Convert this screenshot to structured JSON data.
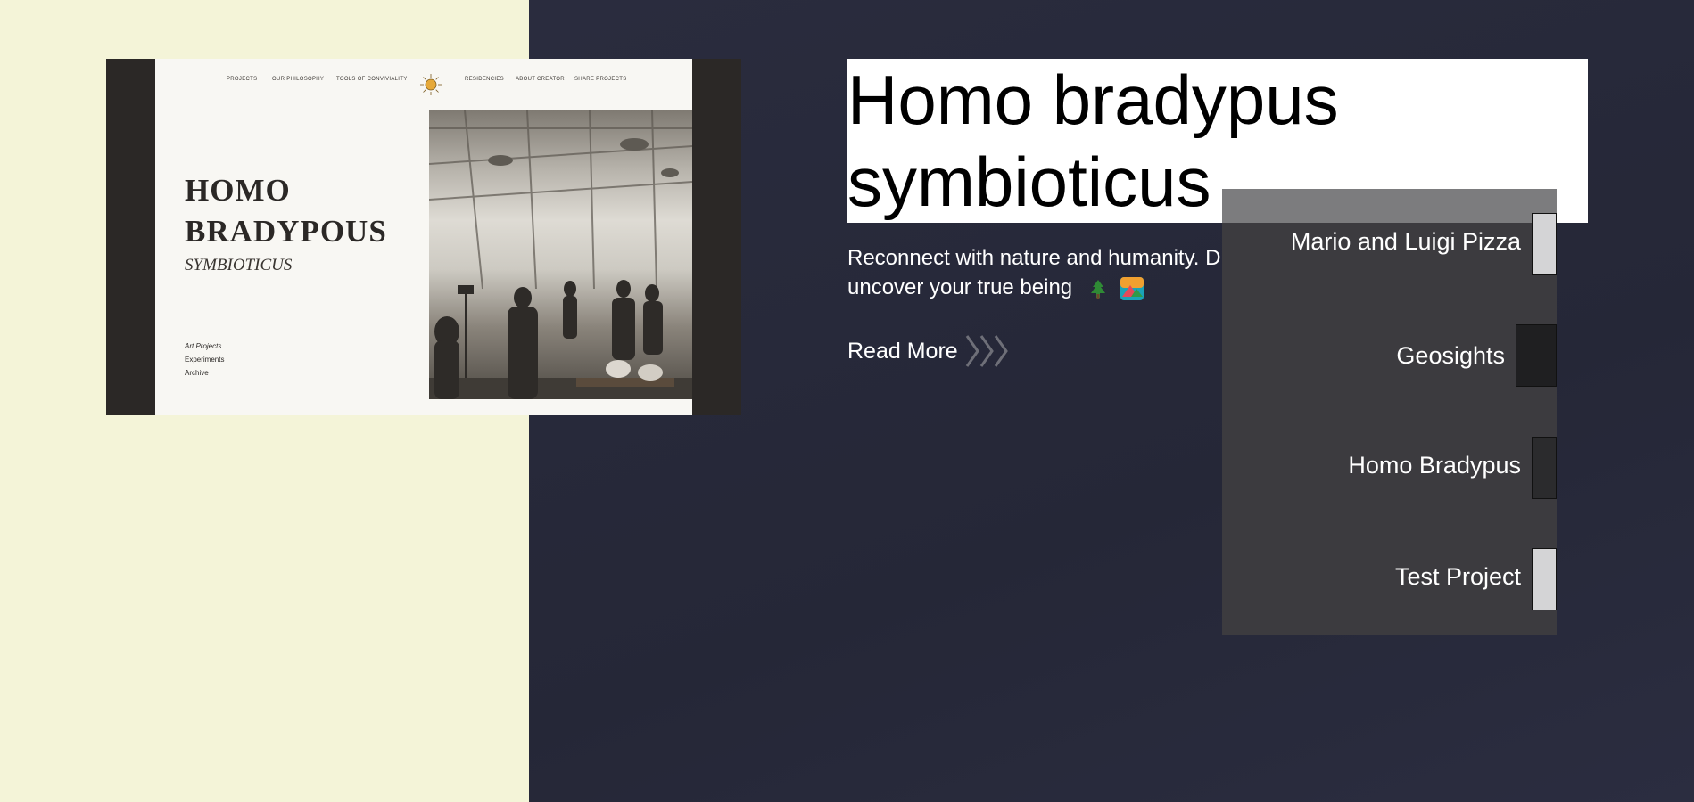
{
  "preview": {
    "nav": [
      "PROJECTS",
      "OUR PHILOSOPHY",
      "TOOLS OF CONVIVIALITY",
      "RESIDENCIES",
      "ABOUT CREATOR",
      "SHARE PROJECTS"
    ],
    "title_line1": "HOMO",
    "title_line2": "BRADYPOUS",
    "subtitle": "SYMBIOTICUS",
    "links": [
      "Art Projects",
      "Experiments",
      "Archive"
    ]
  },
  "main": {
    "title": "Homo bradypus symbioticus",
    "description": "Reconnect with nature and humanity. Discover art and artist to uncover your true being",
    "read_more": "Read More"
  },
  "menu": {
    "items": [
      {
        "label": "Mario and Luigi Pizza"
      },
      {
        "label": "Geosights"
      },
      {
        "label": "Homo Bradypus"
      },
      {
        "label": "Test Project"
      }
    ]
  },
  "colors": {
    "left_bg": "#f4f4d8",
    "right_bg": "#262838",
    "overlay_bg": "#3c3b3f",
    "title_box_bg": "#ffffff"
  },
  "icons": [
    "sun-logo-icon",
    "tree-emoji-icon",
    "mountain-emoji-icon",
    "chevron-right-icon"
  ]
}
